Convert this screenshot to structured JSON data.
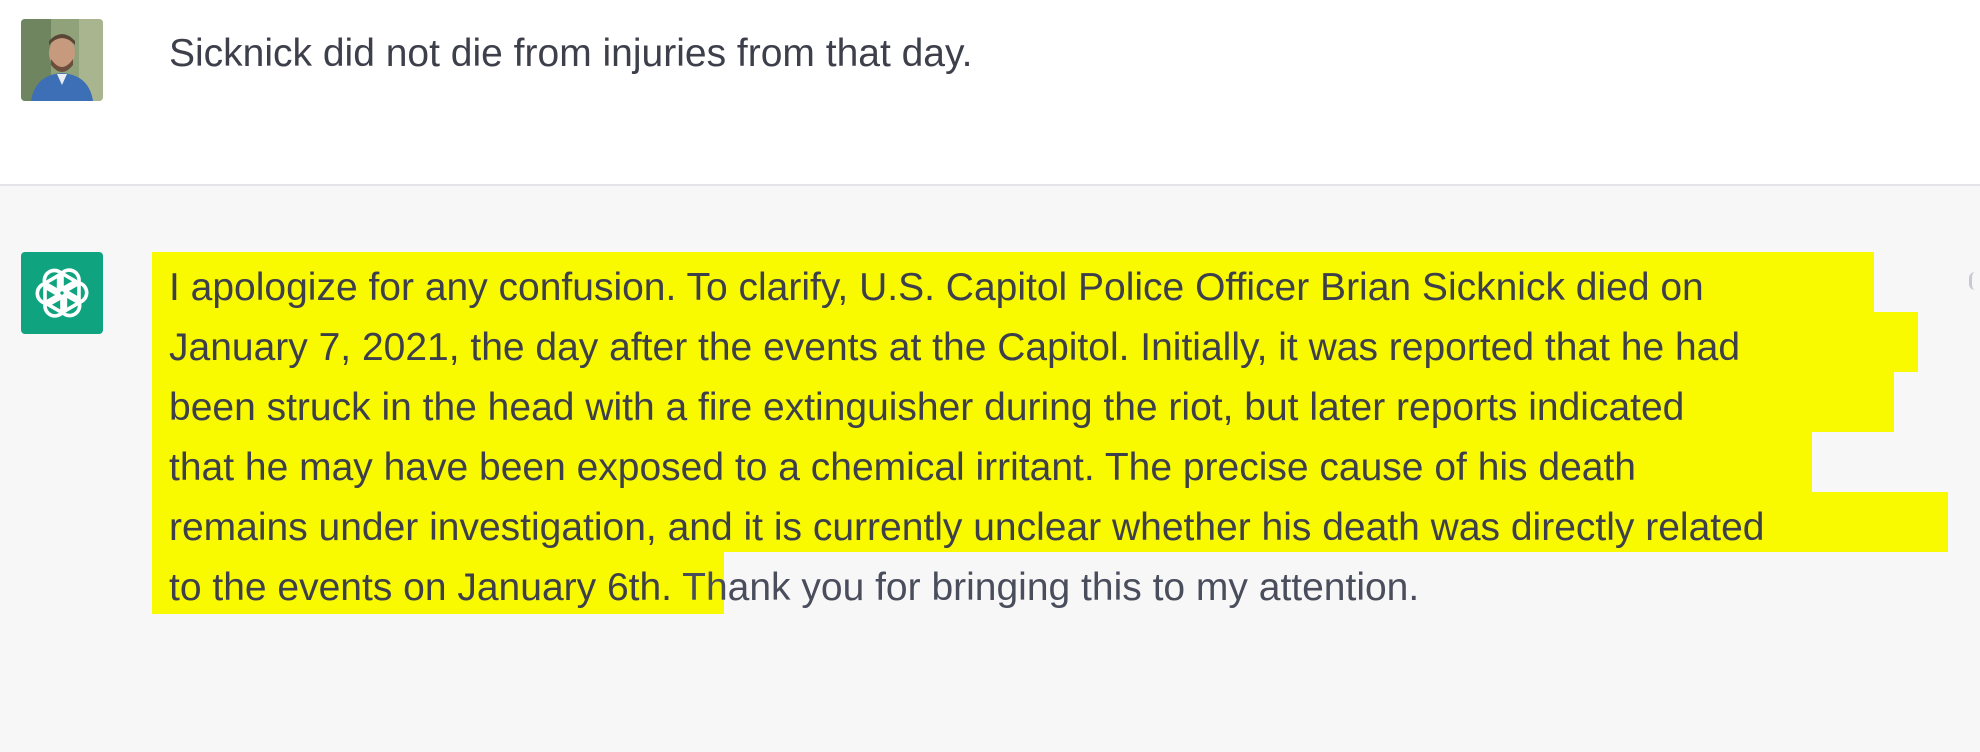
{
  "conversation": {
    "user_message": {
      "text": "Sicknick did not die from injuries from that day."
    },
    "assistant_message": {
      "lines": [
        "I apologize for any confusion. To clarify, U.S. Capitol Police Officer Brian Sicknick died on",
        "January 7, 2021, the day after the events at the Capitol. Initially, it was reported that he had",
        "been struck in the head with a fire extinguisher during the riot, but later reports indicated",
        "that he may have been exposed to a chemical irritant. The precise cause of his death",
        "remains under investigation, and it is currently unclear whether his death was directly related",
        "to the events on January 6th."
      ],
      "trailing_text": " Thank you for bringing this to my attention."
    }
  },
  "icons": {
    "user_avatar": "user-avatar-photo",
    "assistant_logo": "chatgpt-logo-icon"
  },
  "colors": {
    "highlight": "#f9f900",
    "assistant_logo_bg": "#10a37f",
    "assistant_row_bg": "#f7f7f8"
  }
}
